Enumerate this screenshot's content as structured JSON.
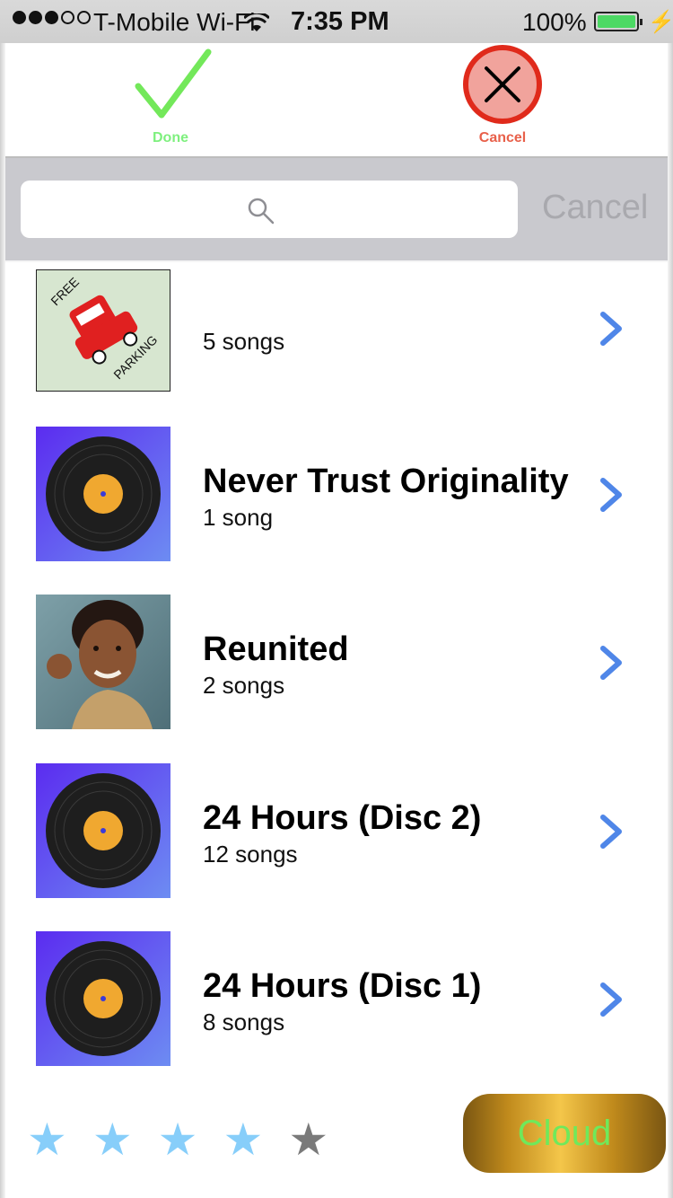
{
  "status_bar": {
    "carrier": "T-Mobile Wi-Fi",
    "time": "7:35 PM",
    "battery_percent": "100%",
    "signal_bars_filled": 3,
    "signal_bars_total": 5
  },
  "top_bar": {
    "done_label": "Done",
    "cancel_label": "Cancel",
    "done_color": "#7ef07e",
    "cancel_color": "#e8604a"
  },
  "search": {
    "placeholder": "",
    "value": "",
    "cancel_label": "Cancel"
  },
  "albums": [
    {
      "title": "",
      "subtitle": "5 songs",
      "art": "free-parking"
    },
    {
      "title": "Never Trust Originality",
      "subtitle": "1 song",
      "art": "vinyl-record"
    },
    {
      "title": "Reunited",
      "subtitle": "2 songs",
      "art": "photo-boy"
    },
    {
      "title": "24 Hours (Disc 2)",
      "subtitle": "12 songs",
      "art": "vinyl-record"
    },
    {
      "title": "24 Hours (Disc 1)",
      "subtitle": "8 songs",
      "art": "vinyl-record"
    }
  ],
  "art_text": {
    "free": "FREE",
    "parking": "PARKING"
  },
  "rating": {
    "value": 4,
    "max": 5,
    "filled_color": "#87cefa",
    "empty_color": "#7a7a7a"
  },
  "cloud_button": {
    "label": "Cloud",
    "text_color": "#6fe95b"
  },
  "accent_color": "#4f86e8"
}
